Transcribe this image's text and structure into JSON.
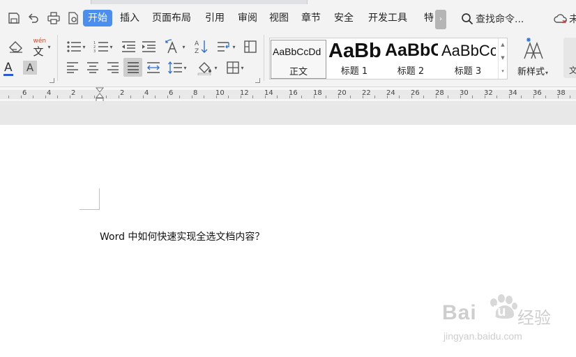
{
  "menubar": {
    "tabs": [
      {
        "label": "开始",
        "active": true
      },
      {
        "label": "插入"
      },
      {
        "label": "页面布局"
      },
      {
        "label": "引用"
      },
      {
        "label": "审阅"
      },
      {
        "label": "视图"
      },
      {
        "label": "章节"
      },
      {
        "label": "安全"
      },
      {
        "label": "开发工具"
      },
      {
        "label": "特"
      }
    ],
    "more_glyph": "›",
    "search_label": "查找命令...",
    "cloud_label": "未",
    "accent_color": "#4a8ef0"
  },
  "quick_access_icons": [
    "save-icon",
    "undo-icon",
    "print-icon",
    "print-preview-icon"
  ],
  "ribbon": {
    "font_group": {
      "clear_format_icon": "eraser-icon",
      "phonetic_glyph": "文",
      "phonetic_ruby": "wén",
      "font_color_glyph": "A",
      "char_shading_glyph": "A"
    },
    "styles": [
      {
        "sample": "AaBbCcDd",
        "label": "正文",
        "selected": true
      },
      {
        "sample": "AaBb",
        "label": "标题 1"
      },
      {
        "sample": "AaBbC",
        "label": "标题 2"
      },
      {
        "sample": "AaBbCc",
        "label": "标题 3"
      }
    ],
    "new_style_label": "新样式",
    "right_cut_label": "文"
  },
  "ruler": {
    "left_labels": [
      "6",
      "4",
      "2"
    ],
    "right_labels": [
      "2",
      "4",
      "6",
      "8",
      "10",
      "12",
      "14",
      "16",
      "18",
      "20",
      "22",
      "24",
      "26",
      "28",
      "30",
      "32",
      "34",
      "36",
      "38"
    ]
  },
  "document": {
    "text": "Word 中如何快速实现全选文档内容？"
  },
  "watermark": {
    "brand": "Bai",
    "brand2": "du",
    "suffix": "经验",
    "url": "jingyan.baidu.com"
  }
}
